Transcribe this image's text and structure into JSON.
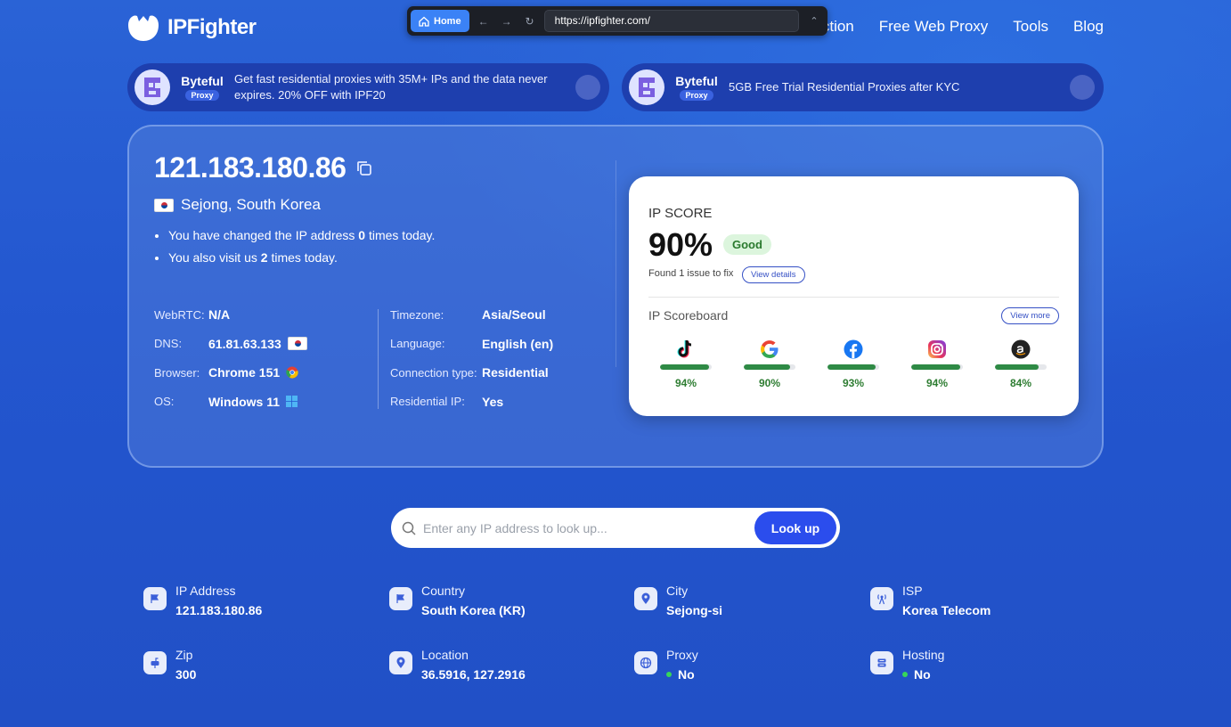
{
  "brand": {
    "name": "IPFighter"
  },
  "nav": {
    "items": [
      "ection",
      "Free Web Proxy",
      "Tools",
      "Blog"
    ]
  },
  "browser": {
    "home_label": "Home",
    "url": "https://ipfighter.com/"
  },
  "ads": [
    {
      "brand": "Byteful",
      "tag": "Proxy",
      "text": "Get fast residential proxies with 35M+ IPs and the data never expires. 20% OFF with IPF20"
    },
    {
      "brand": "Byteful",
      "tag": "Proxy",
      "text": "5GB Free Trial Residential Proxies after KYC"
    }
  ],
  "main": {
    "ip": "121.183.180.86",
    "location": "Sejong, South Korea",
    "bullet1": {
      "pre": "You have changed the IP address ",
      "count": "0",
      "post": " times today."
    },
    "bullet2": {
      "pre": "You also visit us ",
      "count": "2",
      "post": " times today."
    },
    "left_kv": [
      {
        "k": "WebRTC:",
        "v": "N/A"
      },
      {
        "k": "DNS:",
        "v": "61.81.63.133"
      },
      {
        "k": "Browser:",
        "v": "Chrome 151"
      },
      {
        "k": "OS:",
        "v": "Windows 11"
      }
    ],
    "right_kv": [
      {
        "k": "Timezone:",
        "v": "Asia/Seoul"
      },
      {
        "k": "Language:",
        "v": "English (en)"
      },
      {
        "k": "Connection type:",
        "v": "Residential"
      },
      {
        "k": "Residential IP:",
        "v": "Yes"
      }
    ]
  },
  "score": {
    "label": "IP SCORE",
    "value": "90%",
    "badge": "Good",
    "found": "Found 1 issue to fix",
    "view_details": "View details",
    "scoreboard": "IP Scoreboard",
    "view_more": "View more",
    "services": [
      {
        "icon": "tiktok-icon",
        "pct": "94%",
        "fill": 0.94
      },
      {
        "icon": "google-icon",
        "pct": "90%",
        "fill": 0.9
      },
      {
        "icon": "facebook-icon",
        "pct": "93%",
        "fill": 0.93
      },
      {
        "icon": "instagram-icon",
        "pct": "94%",
        "fill": 0.94
      },
      {
        "icon": "amazon-icon",
        "pct": "84%",
        "fill": 0.84
      }
    ]
  },
  "search": {
    "placeholder": "Enter any IP address to look up...",
    "button": "Look up"
  },
  "info": [
    {
      "title": "IP Address",
      "value": "121.183.180.86"
    },
    {
      "title": "Country",
      "value": "South Korea (KR)"
    },
    {
      "title": "City",
      "value": "Sejong-si"
    },
    {
      "title": "ISP",
      "value": "Korea Telecom"
    },
    {
      "title": "Zip",
      "value": "300"
    },
    {
      "title": "Location",
      "value": "36.5916, 127.2916"
    },
    {
      "title": "Proxy",
      "value": "No"
    },
    {
      "title": "Hosting",
      "value": "No"
    }
  ],
  "colors": {
    "accent": "#2b4ded",
    "good": "#2e8a45"
  }
}
